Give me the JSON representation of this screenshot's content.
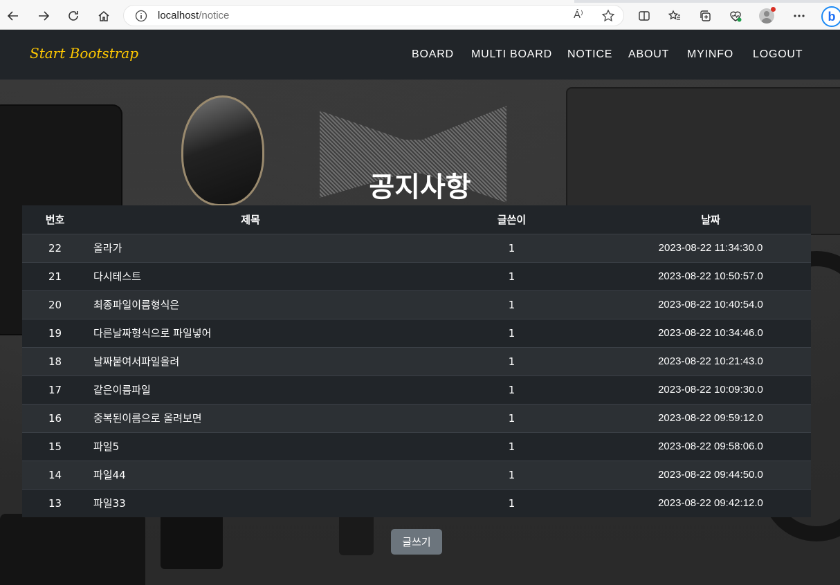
{
  "browser": {
    "url_host": "localhost",
    "url_path": "/notice",
    "read_aloud_label": "Á⁾",
    "bing_label": "b"
  },
  "navbar": {
    "brand": "Start Bootstrap",
    "links": [
      "BOARD",
      "MULTI BOARD",
      "NOTICE",
      "ABOUT",
      "MYINFO",
      "LOGOUT"
    ]
  },
  "page": {
    "title": "공지사항"
  },
  "table": {
    "headers": [
      "번호",
      "제목",
      "글쓴이",
      "날짜"
    ],
    "rows": [
      {
        "num": "22",
        "title": "올라가",
        "author": "1",
        "date": "2023-08-22 11:34:30.0"
      },
      {
        "num": "21",
        "title": "다시테스트",
        "author": "1",
        "date": "2023-08-22 10:50:57.0"
      },
      {
        "num": "20",
        "title": "최종파일이름형식은",
        "author": "1",
        "date": "2023-08-22 10:40:54.0"
      },
      {
        "num": "19",
        "title": "다른날짜형식으로 파일넣어",
        "author": "1",
        "date": "2023-08-22 10:34:46.0"
      },
      {
        "num": "18",
        "title": "날짜붙여서파일올려",
        "author": "1",
        "date": "2023-08-22 10:21:43.0"
      },
      {
        "num": "17",
        "title": "같은이름파일",
        "author": "1",
        "date": "2023-08-22 10:09:30.0"
      },
      {
        "num": "16",
        "title": "중복된이름으로 올려보면",
        "author": "1",
        "date": "2023-08-22 09:59:12.0"
      },
      {
        "num": "15",
        "title": "파일5",
        "author": "1",
        "date": "2023-08-22 09:58:06.0"
      },
      {
        "num": "14",
        "title": "파일44",
        "author": "1",
        "date": "2023-08-22 09:44:50.0"
      },
      {
        "num": "13",
        "title": "파일33",
        "author": "1",
        "date": "2023-08-22 09:42:12.0"
      }
    ]
  },
  "actions": {
    "write_label": "글쓰기"
  },
  "colors": {
    "brand": "#ffc800",
    "navbar_bg": "#212529",
    "button_bg": "#6c757d"
  }
}
